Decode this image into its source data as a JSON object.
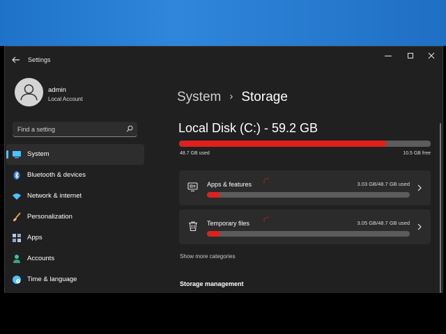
{
  "window": {
    "title": "Settings"
  },
  "user": {
    "name": "admin",
    "account_type": "Local Account"
  },
  "search": {
    "placeholder": "Find a setting"
  },
  "sidebar": {
    "items": [
      {
        "label": "System",
        "icon": "monitor-icon",
        "active": true
      },
      {
        "label": "Bluetooth & devices",
        "icon": "bluetooth-icon",
        "active": false
      },
      {
        "label": "Network & internet",
        "icon": "wifi-icon",
        "active": false
      },
      {
        "label": "Personalization",
        "icon": "brush-icon",
        "active": false
      },
      {
        "label": "Apps",
        "icon": "apps-icon",
        "active": false
      },
      {
        "label": "Accounts",
        "icon": "person-icon",
        "active": false
      },
      {
        "label": "Time & language",
        "icon": "clock-globe-icon",
        "active": false
      }
    ]
  },
  "breadcrumb": {
    "parent": "System",
    "separator": "›",
    "current": "Storage"
  },
  "disk": {
    "title": "Local Disk (C:) - 59.2 GB",
    "used_text": "48.7 GB used",
    "free_text": "10.5 GB free",
    "used_fraction": 0.823
  },
  "categories": [
    {
      "label": "Apps & features",
      "usage": "3.03 GB/48.7 GB used",
      "fraction": 0.062,
      "icon": "apps-features-icon"
    },
    {
      "label": "Temporary files",
      "usage": "3.05 GB/48.7 GB used",
      "fraction": 0.063,
      "icon": "trash-icon"
    }
  ],
  "links": {
    "show_more": "Show more categories"
  },
  "sections": {
    "storage_management": "Storage management"
  },
  "colors": {
    "accent": "#4cc2ff",
    "bar_fill": "#e0201c",
    "bar_track": "#5c5c5c",
    "window_bg": "#202020",
    "card_bg": "#2b2b2b"
  }
}
